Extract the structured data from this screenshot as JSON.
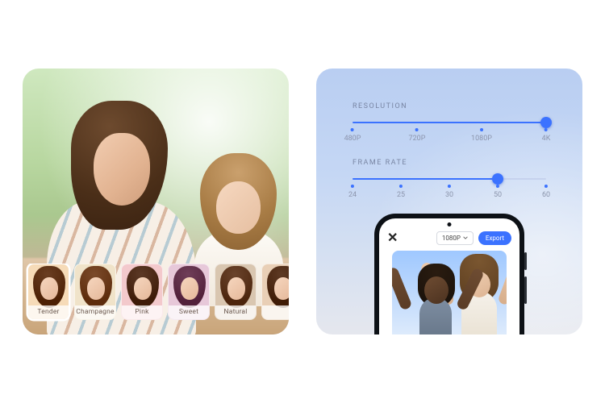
{
  "filters": {
    "items": [
      {
        "label": "Tender",
        "bg": "#f6dbb8",
        "hair": "#6a3e22",
        "selected": true
      },
      {
        "label": "Champagne",
        "bg": "#f0e3c9",
        "hair": "#7b4a2a",
        "selected": false
      },
      {
        "label": "Pink",
        "bg": "#f3c9cc",
        "hair": "#5c3926",
        "selected": false
      },
      {
        "label": "Sweet",
        "bg": "#e7c8d9",
        "hair": "#6f3e58",
        "selected": false
      },
      {
        "label": "Natural",
        "bg": "#d9c6b0",
        "hair": "#6a432b",
        "selected": false
      },
      {
        "label": "",
        "bg": "#e9cfb6",
        "hair": "#5e3a24",
        "selected": false
      }
    ]
  },
  "settings": {
    "resolution": {
      "title": "RESOLUTION",
      "options": [
        "480P",
        "720P",
        "1080P",
        "4K"
      ],
      "selected_index": 3
    },
    "frame_rate": {
      "title": "FRAME RATE",
      "options": [
        "24",
        "25",
        "30",
        "50",
        "60"
      ],
      "selected_index": 3
    }
  },
  "export_ui": {
    "close_glyph": "✕",
    "resolution_pill": "1080P",
    "export_label": "Export"
  },
  "colors": {
    "accent": "#3b72ff"
  }
}
